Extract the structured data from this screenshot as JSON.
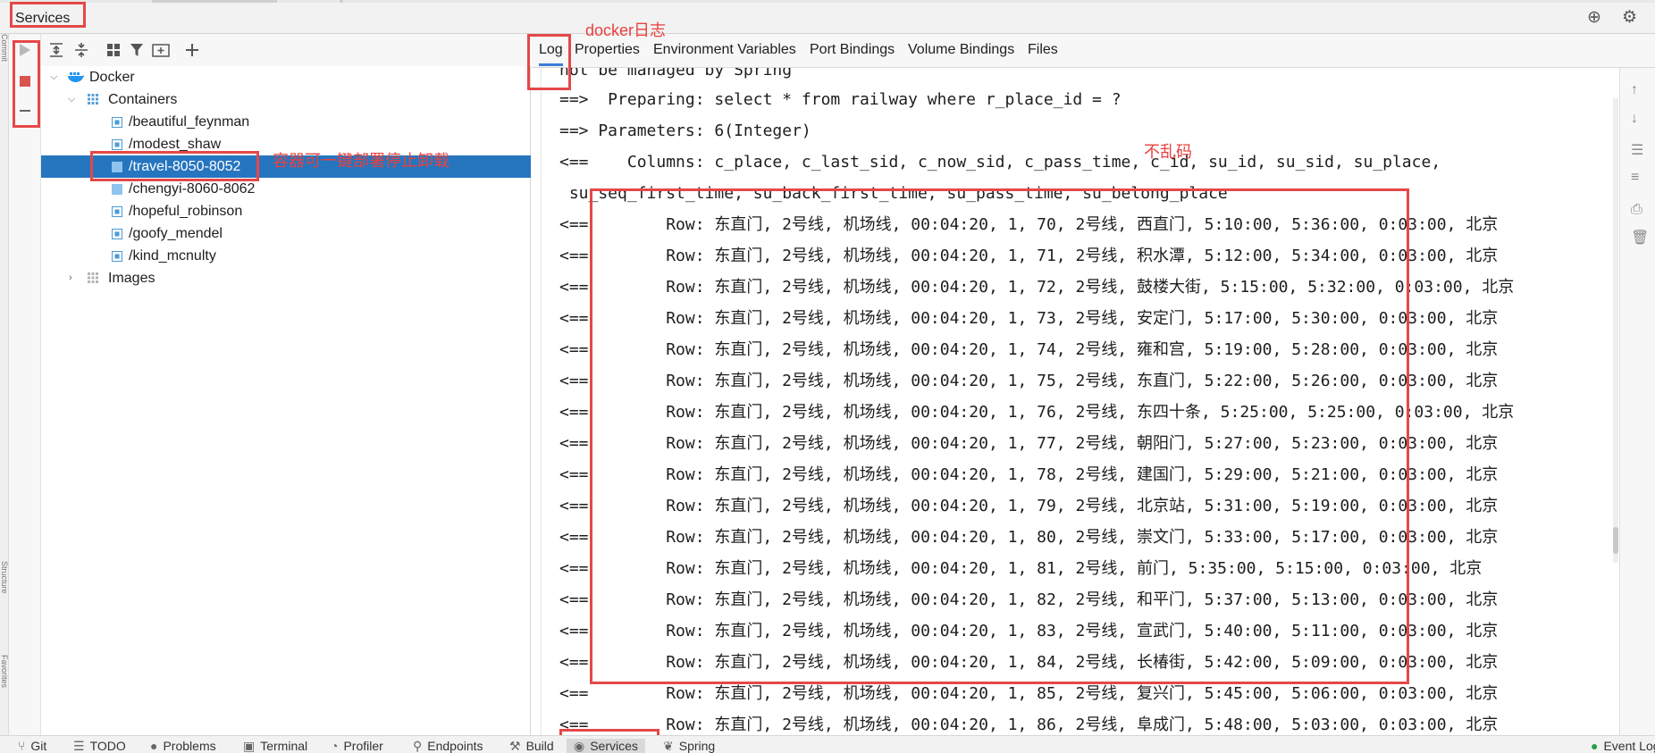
{
  "title": "Services",
  "toolbar": {
    "icons": [
      "expand-all-icon",
      "collapse-all-icon",
      "group-icon",
      "filter-icon",
      "new-group-icon",
      "add-icon"
    ]
  },
  "left_actions": {
    "icons": [
      "run-icon",
      "stop-icon",
      "minus-icon"
    ]
  },
  "tree": {
    "root": "Docker",
    "containers_label": "Containers",
    "containers": [
      "/beautiful_feynman",
      "/modest_shaw",
      "/travel-8050-8052",
      "/chengyi-8060-8062",
      "/hopeful_robinson",
      "/goofy_mendel",
      "/kind_mcnulty"
    ],
    "images_label": "Images",
    "selected": "/travel-8050-8052"
  },
  "annotations": {
    "docker_log": "docker日志",
    "no_garble": "不乱码",
    "container_actions": "容器可一键部署停止卸载"
  },
  "tabs": [
    "Log",
    "Properties",
    "Environment Variables",
    "Port Bindings",
    "Volume Bindings",
    "Files"
  ],
  "active_tab": "Log",
  "log": {
    "lines": [
      "not be managed by Spring",
      "==>  Preparing: select * from railway where r_place_id = ?",
      "==> Parameters: 6(Integer)",
      "<==    Columns: c_place, c_last_sid, c_now_sid, c_pass_time, c_id, su_id, su_sid, su_place,",
      " su_seq_first_time, su_back_first_time, su_pass_time, su_belong_place",
      "<==        Row: 东直门, 2号线, 机场线, 00:04:20, 1, 70, 2号线, 西直门, 5:10:00, 5:36:00, 0:03:00, 北京",
      "<==        Row: 东直门, 2号线, 机场线, 00:04:20, 1, 71, 2号线, 积水潭, 5:12:00, 5:34:00, 0:03:00, 北京",
      "<==        Row: 东直门, 2号线, 机场线, 00:04:20, 1, 72, 2号线, 鼓楼大街, 5:15:00, 5:32:00, 0:03:00, 北京",
      "<==        Row: 东直门, 2号线, 机场线, 00:04:20, 1, 73, 2号线, 安定门, 5:17:00, 5:30:00, 0:03:00, 北京",
      "<==        Row: 东直门, 2号线, 机场线, 00:04:20, 1, 74, 2号线, 雍和宫, 5:19:00, 5:28:00, 0:03:00, 北京",
      "<==        Row: 东直门, 2号线, 机场线, 00:04:20, 1, 75, 2号线, 东直门, 5:22:00, 5:26:00, 0:03:00, 北京",
      "<==        Row: 东直门, 2号线, 机场线, 00:04:20, 1, 76, 2号线, 东四十条, 5:25:00, 5:25:00, 0:03:00, 北京",
      "<==        Row: 东直门, 2号线, 机场线, 00:04:20, 1, 77, 2号线, 朝阳门, 5:27:00, 5:23:00, 0:03:00, 北京",
      "<==        Row: 东直门, 2号线, 机场线, 00:04:20, 1, 78, 2号线, 建国门, 5:29:00, 5:21:00, 0:03:00, 北京",
      "<==        Row: 东直门, 2号线, 机场线, 00:04:20, 1, 79, 2号线, 北京站, 5:31:00, 5:19:00, 0:03:00, 北京",
      "<==        Row: 东直门, 2号线, 机场线, 00:04:20, 1, 80, 2号线, 崇文门, 5:33:00, 5:17:00, 0:03:00, 北京",
      "<==        Row: 东直门, 2号线, 机场线, 00:04:20, 1, 81, 2号线, 前门, 5:35:00, 5:15:00, 0:03:00, 北京",
      "<==        Row: 东直门, 2号线, 机场线, 00:04:20, 1, 82, 2号线, 和平门, 5:37:00, 5:13:00, 0:03:00, 北京",
      "<==        Row: 东直门, 2号线, 机场线, 00:04:20, 1, 83, 2号线, 宣武门, 5:40:00, 5:11:00, 0:03:00, 北京",
      "<==        Row: 东直门, 2号线, 机场线, 00:04:20, 1, 84, 2号线, 长椿街, 5:42:00, 5:09:00, 0:03:00, 北京",
      "<==        Row: 东直门, 2号线, 机场线, 00:04:20, 1, 85, 2号线, 复兴门, 5:45:00, 5:06:00, 0:03:00, 北京",
      "<==        Row: 东直门, 2号线, 机场线, 00:04:20, 1, 86, 2号线, 阜成门, 5:48:00, 5:03:00, 0:03:00, 北京"
    ]
  },
  "bottom_tabs": [
    "Git",
    "TODO",
    "Problems",
    "Terminal",
    "Profiler",
    "Endpoints",
    "Build",
    "Services",
    "Spring",
    "Event Log"
  ],
  "active_bottom_tab": "Services",
  "side_labels": {
    "left_top": "Commit",
    "left_mid": "Structure",
    "left_bot": "Favorites"
  },
  "colors": {
    "selection": "#2675bf",
    "annotation": "#e54848",
    "tab_underline": "#3e7bd8",
    "stop": "#d9534f"
  }
}
